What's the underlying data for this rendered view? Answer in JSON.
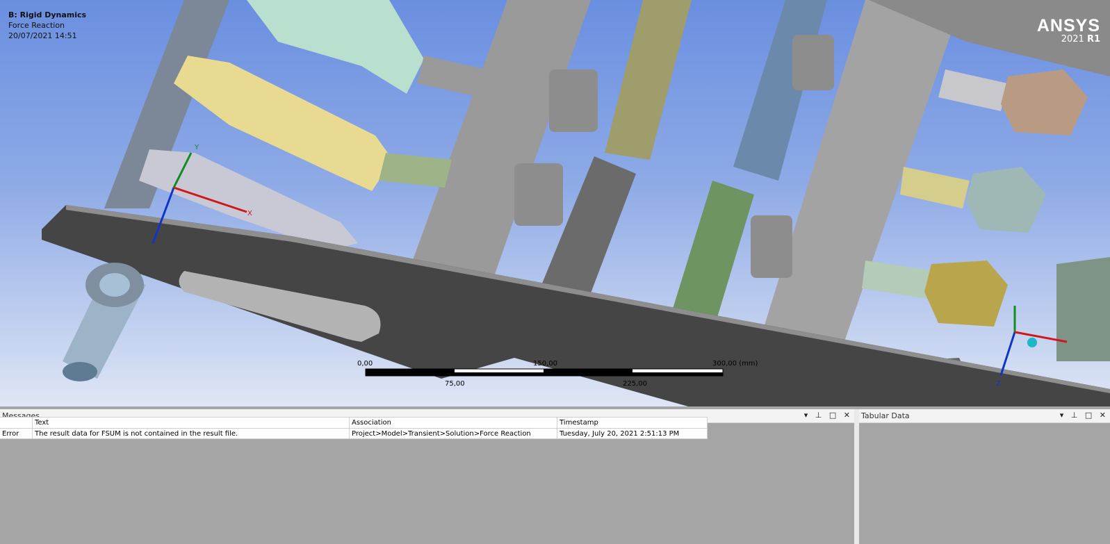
{
  "viewport": {
    "analysis_title": "B: Rigid Dynamics",
    "result_name": "Force Reaction",
    "timestamp": "20/07/2021 14:51",
    "brand": "ANSYS",
    "version_year": "2021",
    "version_release": "R1",
    "scale_labels_top": [
      "0,00",
      "150,00",
      "300,00 (mm)"
    ],
    "scale_labels_bottom": [
      "75,00",
      "225,00"
    ],
    "triad_labels": {
      "x": "X",
      "y": "Y",
      "z": "Z"
    }
  },
  "messages": {
    "title": "Messages",
    "columns": [
      "Text",
      "Association",
      "Timestamp"
    ],
    "rows": [
      {
        "type": "Error",
        "text": "The result data for FSUM is not contained in the result file.",
        "association": "Project>Model>Transient>Solution>Force Reaction",
        "timestamp": "Tuesday, July 20, 2021 2:51:13 PM"
      }
    ]
  },
  "tabular": {
    "title": "Tabular Data"
  },
  "panel_controls": {
    "dropdown": "▾",
    "pin": "⊥",
    "maximize": "□",
    "close": "✕"
  }
}
